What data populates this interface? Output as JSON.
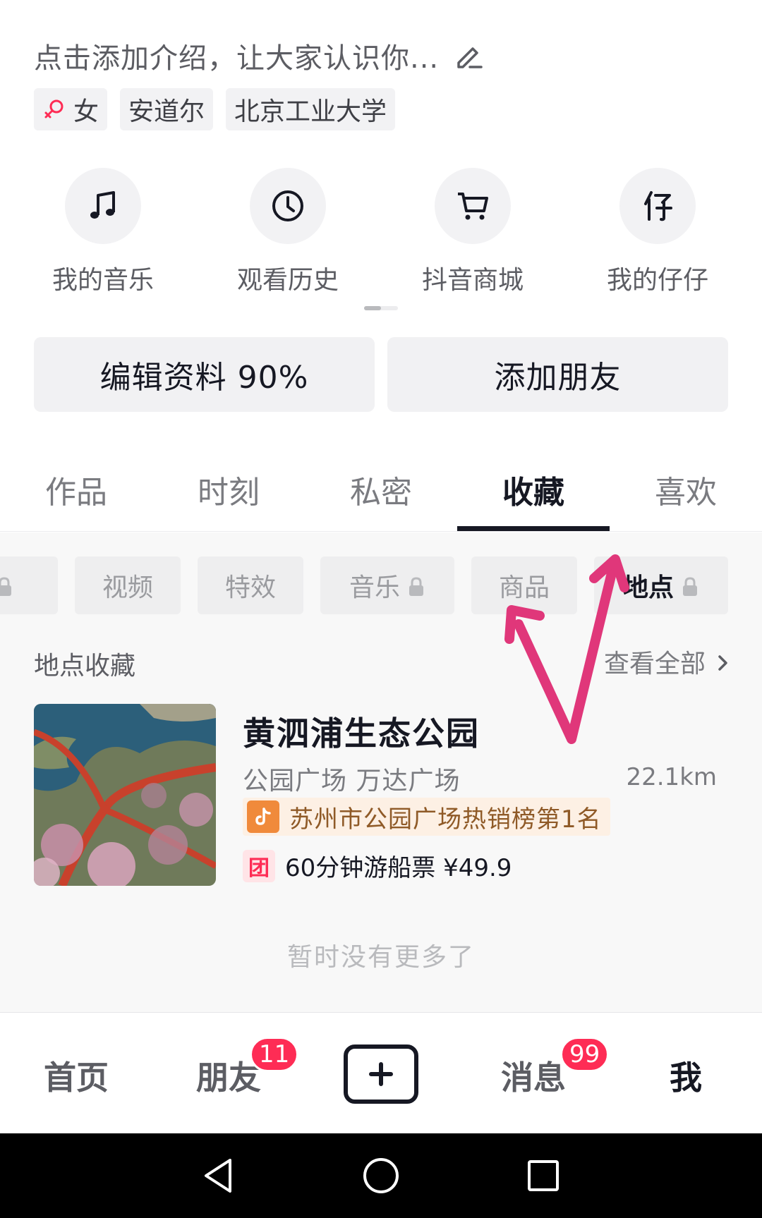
{
  "profile": {
    "bio_placeholder": "点击添加介绍，让大家认识你...",
    "tags": {
      "gender": "女",
      "location": "安道尔",
      "school": "北京工业大学"
    }
  },
  "shortcuts": [
    {
      "label": "我的音乐",
      "icon": "music-note-icon"
    },
    {
      "label": "观看历史",
      "icon": "clock-icon"
    },
    {
      "label": "抖音商城",
      "icon": "cart-icon"
    },
    {
      "label": "我的仔仔",
      "icon": "zaizai-icon"
    }
  ],
  "actions": {
    "edit_profile": "编辑资料 90%",
    "add_friends": "添加朋友"
  },
  "tabs": [
    "作品",
    "时刻",
    "私密",
    "收藏",
    "喜欢"
  ],
  "active_tab": "收藏",
  "chips": [
    "视频",
    "特效",
    "音乐",
    "商品",
    "地点"
  ],
  "active_chip": "地点",
  "place_section": {
    "title": "地点收藏",
    "see_all": "查看全部"
  },
  "place": {
    "name": "黄泗浦生态公园",
    "category": "公园广场  万达广场",
    "distance": "22.1km",
    "rank": "苏州市公园广场热销榜第1名",
    "deal_icon_text": "团",
    "deal": "60分钟游船票 ¥49.9"
  },
  "no_more": "暂时没有更多了",
  "nav": {
    "home": "首页",
    "friends": "朋友",
    "friends_badge": "11",
    "messages": "消息",
    "messages_badge": "99",
    "me": "我"
  },
  "colors": {
    "accent": "#fe2c55",
    "annotation": "#e0377a",
    "text": "#161823"
  }
}
